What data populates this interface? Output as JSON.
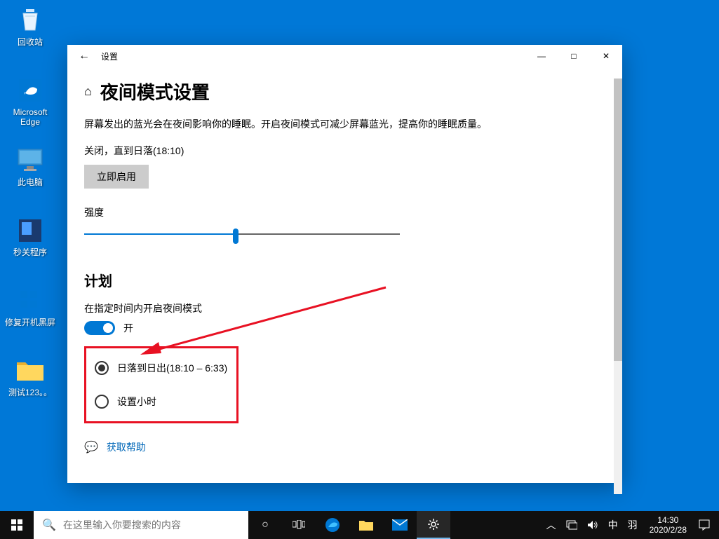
{
  "desktop": {
    "icons": [
      {
        "label": "回收站"
      },
      {
        "label": "Microsoft Edge"
      },
      {
        "label": "此电脑"
      },
      {
        "label": "秒关程序"
      },
      {
        "label": "修复开机黑屏"
      },
      {
        "label": "测试123。。"
      }
    ]
  },
  "window": {
    "title": "设置",
    "controls": {
      "min": "—",
      "max": "□",
      "close": "✕"
    }
  },
  "page": {
    "heading": "夜间模式设置",
    "description": "屏幕发出的蓝光会在夜间影响你的睡眠。开启夜间模式可减少屏幕蓝光，提高你的睡眠质量。",
    "status": "关闭，直到日落(18:10)",
    "enable_button": "立即启用",
    "intensity_label": "强度",
    "intensity_value": 48,
    "schedule_heading": "计划",
    "schedule_sub": "在指定时间内开启夜间模式",
    "toggle_state": "开",
    "radio1": "日落到日出(18:10 – 6:33)",
    "radio2": "设置小时",
    "help": "获取帮助"
  },
  "taskbar": {
    "search_placeholder": "在这里输入你要搜索的内容",
    "ime": "中",
    "ime2": "羽",
    "time": "14:30",
    "date": "2020/2/28"
  }
}
